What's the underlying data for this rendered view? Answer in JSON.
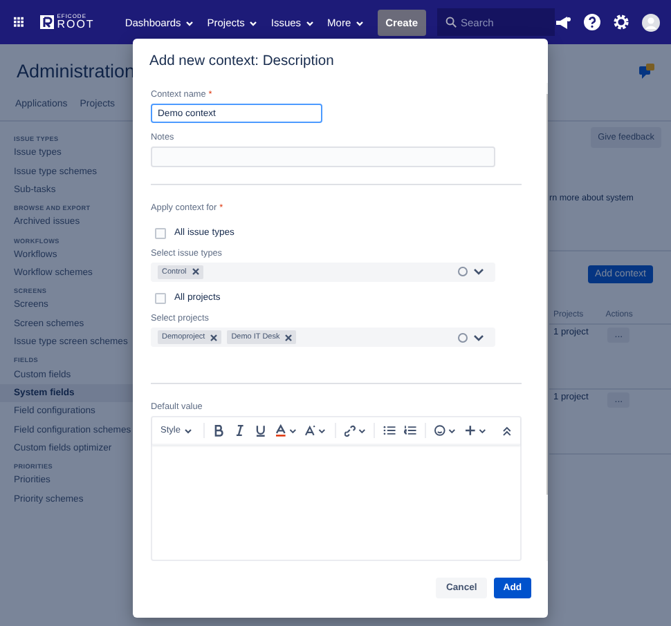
{
  "topnav": {
    "logo_small": "EFICODE",
    "logo_big": "ROOT",
    "menus": [
      "Dashboards",
      "Projects",
      "Issues",
      "More"
    ],
    "create": "Create",
    "search": {
      "placeholder": "Search"
    }
  },
  "page": {
    "title": "Administration",
    "tabs": [
      {
        "label": "Applications"
      },
      {
        "label": "Projects"
      }
    ]
  },
  "sidebar": {
    "sections": [
      {
        "heading": "ISSUE TYPES",
        "items": [
          {
            "label": "Issue types",
            "selected": false
          },
          {
            "label": "Issue type schemes",
            "selected": false
          },
          {
            "label": "Sub-tasks",
            "selected": false
          }
        ]
      },
      {
        "heading": "BROWSE AND EXPORT",
        "items": [
          {
            "label": "Archived issues",
            "selected": false
          }
        ]
      },
      {
        "heading": "WORKFLOWS",
        "items": [
          {
            "label": "Workflows",
            "selected": false
          },
          {
            "label": "Workflow schemes",
            "selected": false
          }
        ]
      },
      {
        "heading": "SCREENS",
        "items": [
          {
            "label": "Screens",
            "selected": false
          },
          {
            "label": "Screen schemes",
            "selected": false
          },
          {
            "label": "Issue type screen schemes",
            "selected": false
          }
        ]
      },
      {
        "heading": "FIELDS",
        "items": [
          {
            "label": "Custom fields",
            "selected": false
          },
          {
            "label": "System fields",
            "selected": true
          },
          {
            "label": "Field configurations",
            "selected": false
          },
          {
            "label": "Field configuration schemes",
            "selected": false
          },
          {
            "label": "Custom fields optimizer",
            "selected": false
          }
        ]
      },
      {
        "heading": "PRIORITIES",
        "items": [
          {
            "label": "Priorities",
            "selected": false
          },
          {
            "label": "Priority schemes",
            "selected": false
          }
        ]
      }
    ]
  },
  "main": {
    "feedback_button": "Give feedback",
    "learn_more": "rn more about system",
    "add_context_button": "Add context",
    "table": {
      "columns": [
        "Projects",
        "Actions"
      ],
      "rows": [
        {
          "projects": "1 project",
          "actions": "..."
        },
        {
          "projects": "1 project",
          "actions": "..."
        }
      ]
    }
  },
  "dialog": {
    "title": "Add new context: Description",
    "required_mark": "*",
    "context_name": {
      "label": "Context name",
      "required": true,
      "value": "Demo context"
    },
    "notes": {
      "label": "Notes"
    },
    "apply_label": "Apply context for",
    "apply_required": true,
    "issue_types": {
      "all_label": "All issue types",
      "all_checked": false,
      "select_label": "Select issue types",
      "tags": [
        "Control"
      ]
    },
    "projects": {
      "all_label": "All projects",
      "all_checked": false,
      "select_label": "Select projects",
      "tags": [
        "Demoproject",
        "Demo IT Desk"
      ]
    },
    "default_value": {
      "label": "Default value",
      "style_menu": "Style"
    },
    "buttons": [
      {
        "label": "Cancel",
        "kind": "secondary"
      },
      {
        "label": "Add",
        "kind": "primary"
      }
    ]
  }
}
